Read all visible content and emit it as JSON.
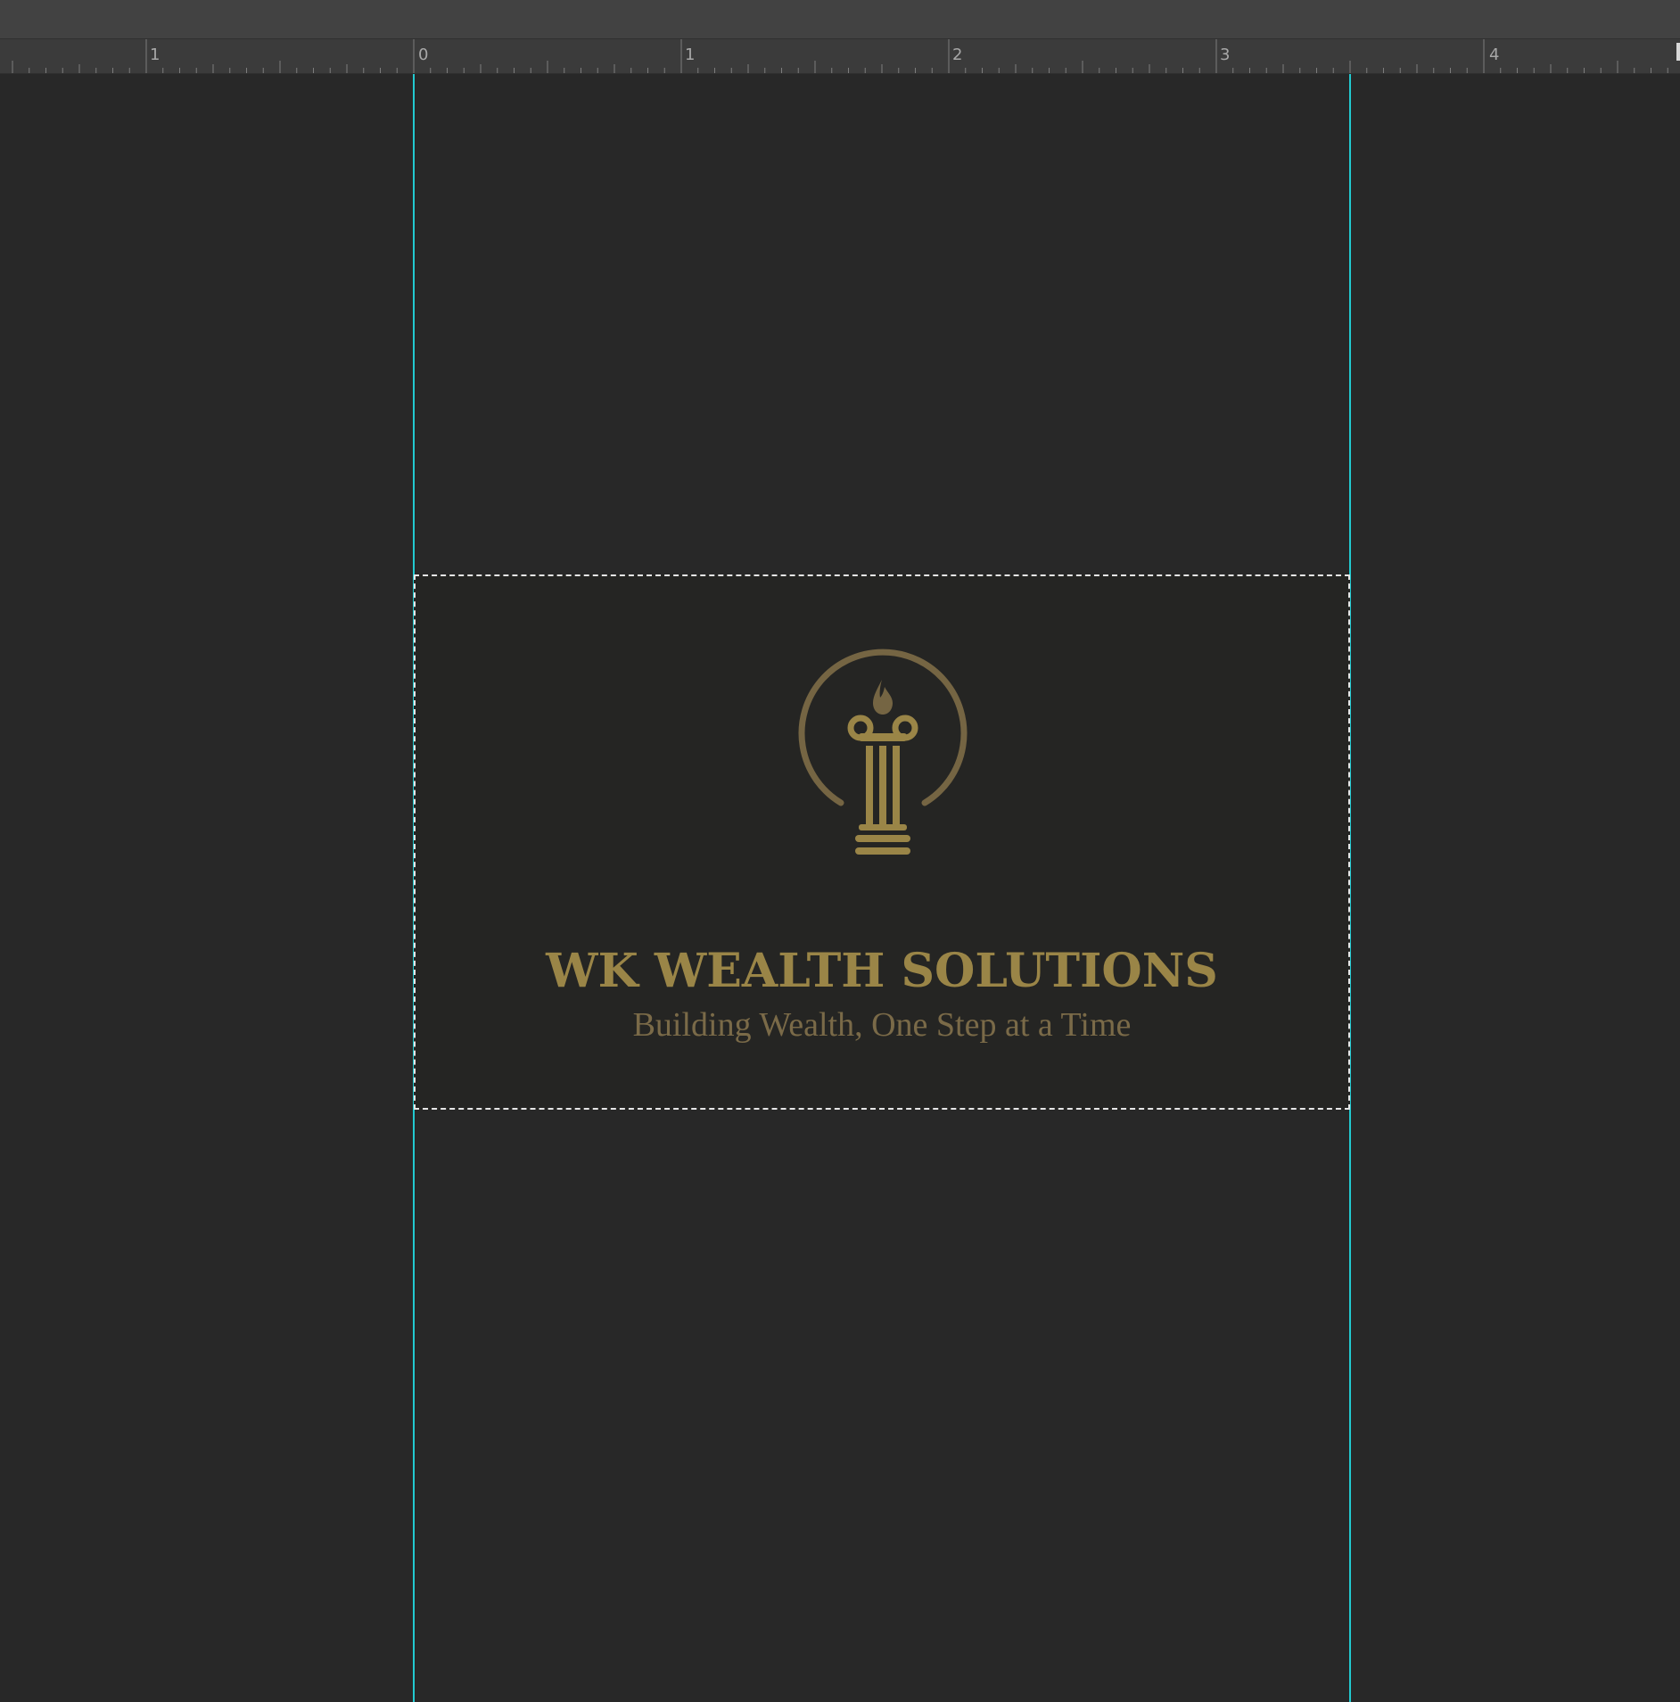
{
  "ruler": {
    "labels": [
      "1",
      "0",
      "1",
      "2",
      "3",
      "4"
    ]
  },
  "artboard": {
    "brand_name": "WK WEALTH SOLUTIONS",
    "tagline": "Building Wealth, One Step at a Time",
    "logo_icon": "column-in-circle-icon"
  },
  "colors": {
    "guide": "#22c9d0",
    "brand_gold": "#9a8547",
    "tagline_brown": "#7a6a48",
    "ring": "#756543",
    "canvas_bg": "#282828"
  }
}
